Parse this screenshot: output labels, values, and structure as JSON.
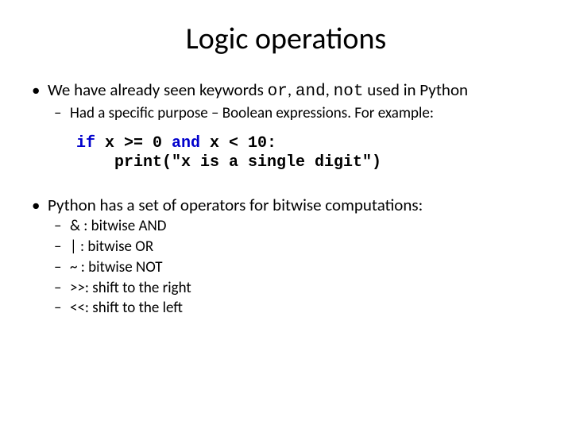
{
  "title": "Logic operations",
  "bullet1": {
    "pre": "We have already seen keywords ",
    "kw1": "or",
    "sep1": ", ",
    "kw2": "and",
    "sep2": ", ",
    "kw3": "not",
    "post": " used in Python",
    "sub1": "Had a specific purpose – Boolean expressions. For example:"
  },
  "code": {
    "line1a": "if",
    "line1b": " x >= 0 ",
    "line1c": "and",
    "line1d": " x < 10:",
    "line2": "    print(\"x is a single digit\")"
  },
  "bullet2": {
    "text": "Python has a set of operators for bitwise computations:",
    "ops": [
      "& : bitwise AND",
      "| : bitwise OR",
      "~ : bitwise NOT",
      ">>: shift to the right",
      "<<: shift to the left"
    ]
  }
}
